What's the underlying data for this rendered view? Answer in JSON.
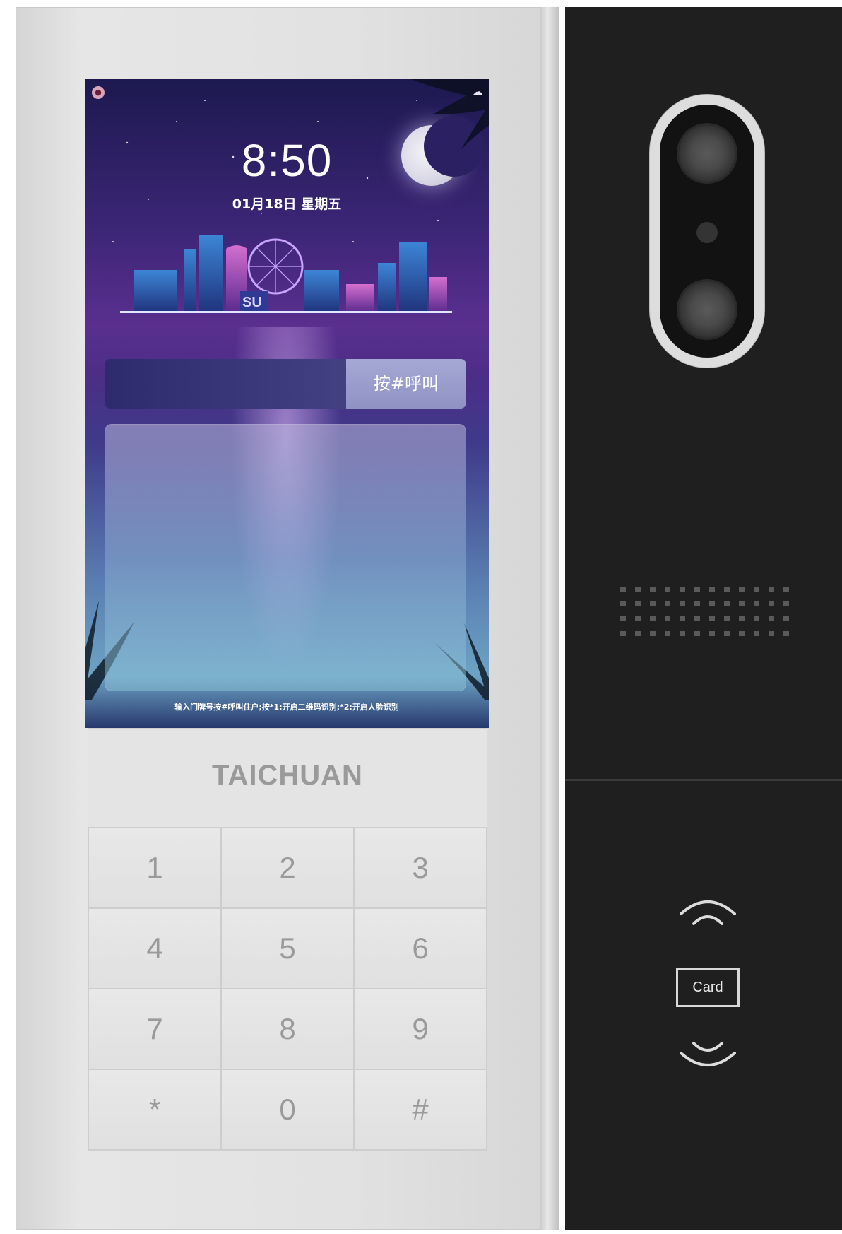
{
  "screen": {
    "time": "8:50",
    "date": "01月18日 星期五",
    "call_input_value": "",
    "call_button_label": "按#呼叫",
    "hint": "输入门牌号按#呼叫住户;按*1:开启二维码识别;*2:开启人脸识别",
    "skyline_sign": "SU"
  },
  "device": {
    "brand": "TAICHUAN",
    "card_label": "Card"
  },
  "keypad": {
    "keys": [
      "1",
      "2",
      "3",
      "4",
      "5",
      "6",
      "7",
      "8",
      "9",
      "*",
      "0",
      "#"
    ]
  },
  "icons": {
    "status_left": "face-recognition-icon",
    "status_right": "cloud-icon",
    "nfc": "nfc-wave-icon"
  },
  "colors": {
    "device_silver": "#e2e2e2",
    "module_black": "#1f1f1f",
    "screen_purple": "#4b2e86",
    "call_button": "#9a9dcc"
  }
}
